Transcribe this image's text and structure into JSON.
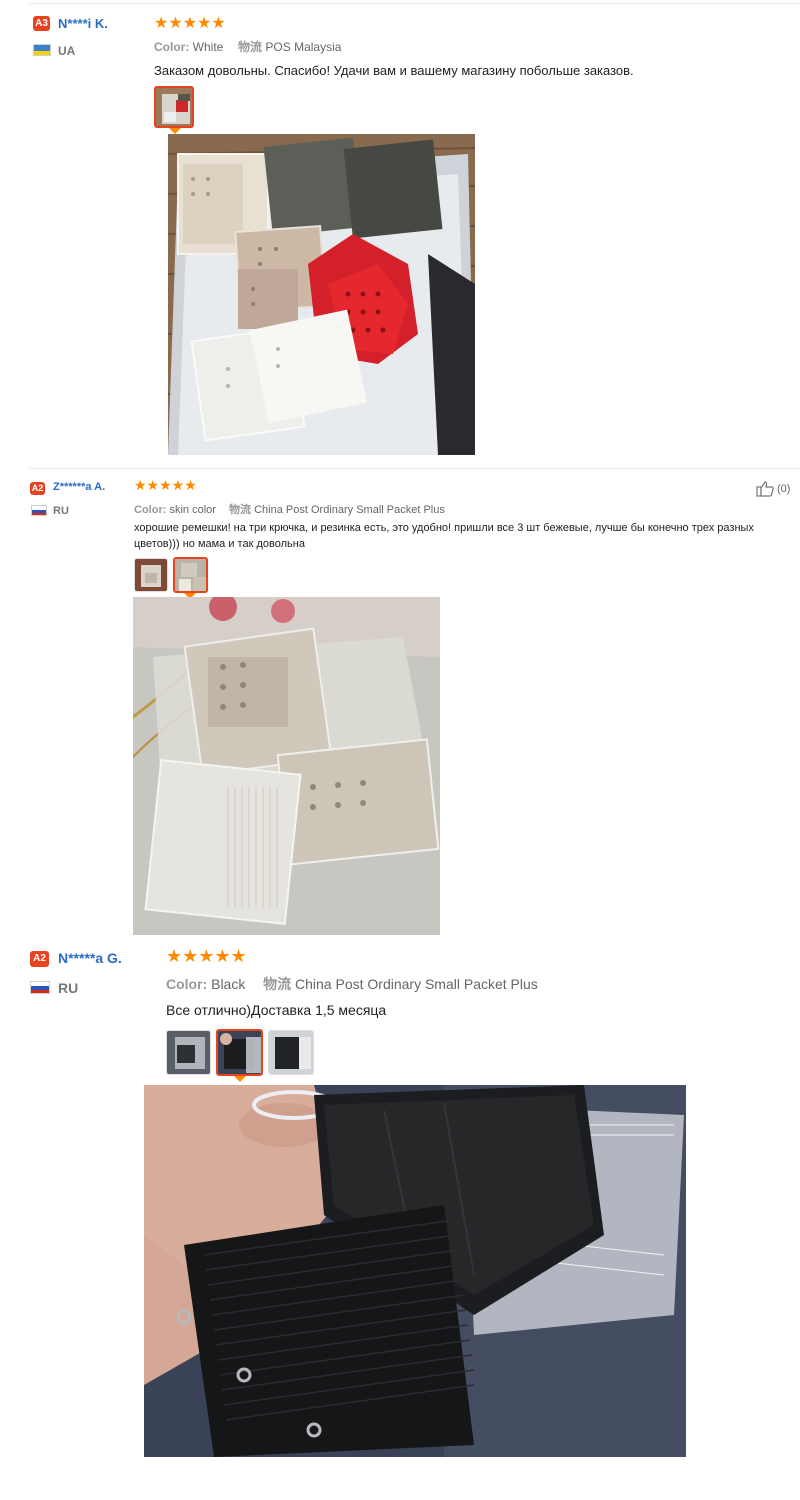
{
  "labels": {
    "color": "Color:",
    "logistics": "物流"
  },
  "reviews": [
    {
      "badge": "A3",
      "name": "N****i K.",
      "country": "UA",
      "stars": "★★★★★",
      "color_value": "White",
      "logistics_value": "POS Malaysia",
      "text": "Заказом довольны. Спасибо! Удачи вам и вашему магазину побольше заказов."
    },
    {
      "badge": "A2",
      "name": "Z******a A.",
      "country": "RU",
      "stars": "★★★★★",
      "color_value": "skin color",
      "logistics_value": "China Post Ordinary Small Packet Plus",
      "text": "хорошие ремешки! на три крючка, и резинка есть, это удобно! пришли все 3 шт бежевые, лучше бы конечно трех разных цветов))) но мама и так довольна",
      "helpful": "(0)"
    },
    {
      "badge": "A2",
      "name": "N*****a G.",
      "country": "RU",
      "stars": "★★★★★",
      "color_value": "Black",
      "logistics_value": "China Post Ordinary Small Packet Plus",
      "text": "Все отлично)Доставка 1,5 месяца"
    }
  ],
  "colors": {
    "accent": "#e8431f",
    "star": "#ff8a00",
    "name": "#2a6cc4"
  },
  "icons": [
    "thumbs-up-icon",
    "ua-flag-icon",
    "ru-flag-icon"
  ]
}
